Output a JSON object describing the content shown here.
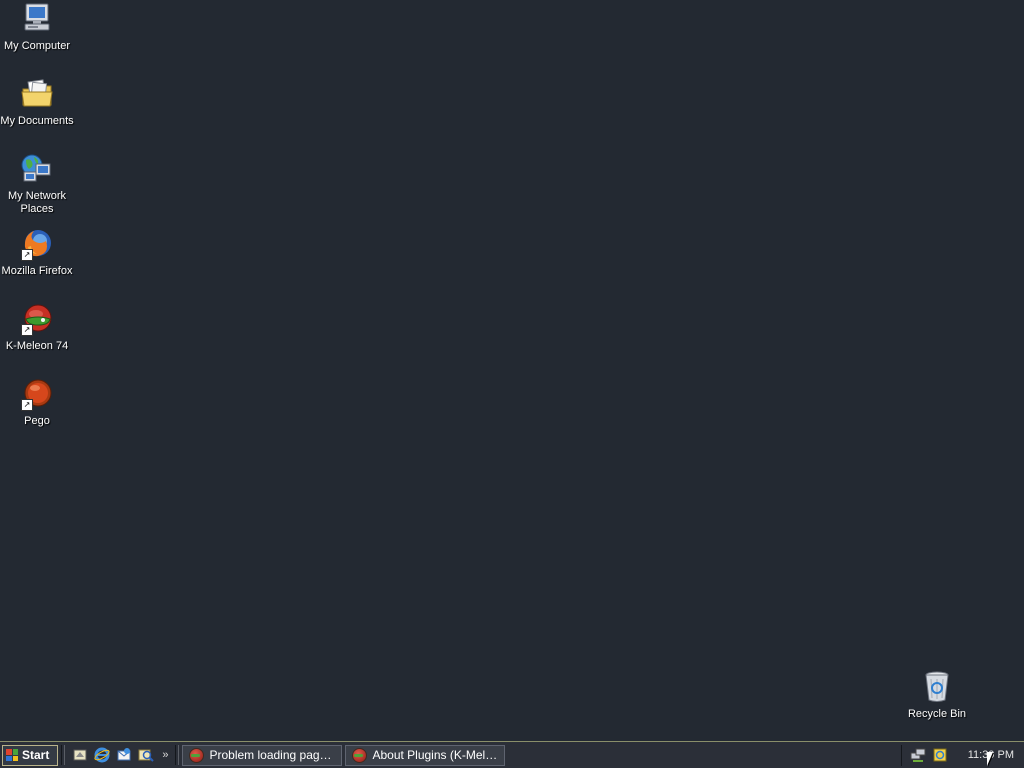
{
  "desktop": {
    "icons": [
      {
        "label": "My Computer",
        "icon": "my-computer-icon"
      },
      {
        "label": "My Documents",
        "icon": "my-documents-icon"
      },
      {
        "label": "My Network Places",
        "icon": "network-places-icon"
      },
      {
        "label": "Mozilla Firefox",
        "icon": "firefox-icon",
        "shortcut": true
      },
      {
        "label": "K-Meleon 74",
        "icon": "kmeleon-icon",
        "shortcut": true
      },
      {
        "label": "Pego",
        "icon": "pego-icon",
        "shortcut": true
      }
    ],
    "recycle_bin": {
      "label": "Recycle Bin",
      "icon": "recycle-bin-icon"
    }
  },
  "taskbar": {
    "start_label": "Start",
    "quick_launch": [
      "show-desktop-icon",
      "internet-explorer-icon",
      "outlook-express-icon",
      "search-icon"
    ],
    "overflow": "»",
    "tasks": [
      {
        "label": "Problem loading page (K-...",
        "icon": "kmeleon-icon"
      },
      {
        "label": "About Plugins (K-Meleon)",
        "icon": "kmeleon-icon"
      }
    ],
    "tray_icons": [
      "network-tray-icon",
      "update-tray-icon"
    ],
    "clock": "11:30 PM"
  },
  "colors": {
    "desktop_bg": "#232932",
    "taskbar_bg": "#2b2f38",
    "taskbar_border": "#8a8f6a"
  }
}
